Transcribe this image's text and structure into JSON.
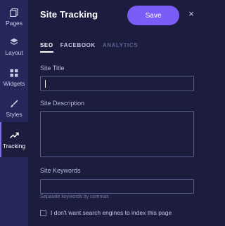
{
  "sidebar": {
    "items": [
      {
        "label": "Pages",
        "icon": "pages-icon"
      },
      {
        "label": "Layout",
        "icon": "layout-icon"
      },
      {
        "label": "Widgets",
        "icon": "widgets-icon"
      },
      {
        "label": "Styles",
        "icon": "brush-icon"
      },
      {
        "label": "Tracking",
        "icon": "trending-icon",
        "active": true
      }
    ]
  },
  "header": {
    "title": "Site Tracking",
    "save_label": "Save",
    "close_symbol": "×"
  },
  "tabs": [
    {
      "label": "SEO",
      "active": true
    },
    {
      "label": "FACEBOOK"
    },
    {
      "label": "ANALYTICS",
      "disabled": true
    }
  ],
  "form": {
    "site_title_label": "Site Title",
    "site_title_value": "",
    "site_description_label": "Site Description",
    "site_description_value": "",
    "site_keywords_label": "Site Keywords",
    "site_keywords_value": "",
    "keywords_hint": "Separate keywords by commas",
    "no_index_label": "I don't want search engines to index this page",
    "no_index_checked": false
  },
  "colors": {
    "background": "#1c1d3e",
    "rail": "#25275a",
    "accent": "#7b5cf6"
  }
}
